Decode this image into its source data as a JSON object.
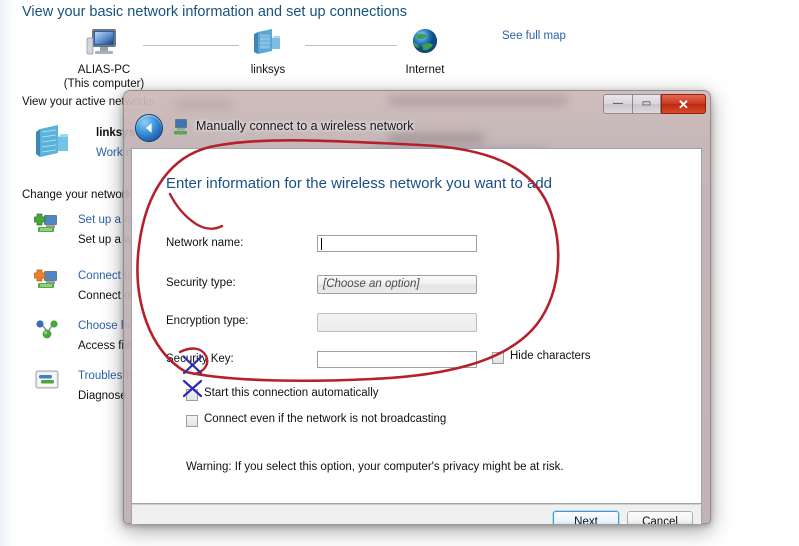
{
  "background_window": {
    "title": "View your basic network information and set up connections",
    "see_full_map_link": "See full map",
    "network_map": {
      "nodes": [
        {
          "icon": "computer-icon",
          "label": "ALIAS-PC",
          "sublabel": "(This computer)"
        },
        {
          "icon": "network-router-icon",
          "label": "linksys",
          "sublabel": ""
        },
        {
          "icon": "globe-icon",
          "label": "Internet",
          "sublabel": ""
        }
      ]
    },
    "active_networks_heading": "View your active networks",
    "active_network": {
      "icon": "network-servers-icon",
      "name": "linksys",
      "type": "Work network"
    },
    "change_settings_heading": "Change your network settings",
    "tasks": [
      {
        "icon": "set-up-connection-icon",
        "link": "Set up a new connection or network",
        "description": "Set up a wireless, broadband, dial-up, ad hoc or VPN connection; or set up a router or access point."
      },
      {
        "icon": "connect-to-network-icon",
        "link": "Connect to a network",
        "description": "Connect or reconnect to a wireless, wired, dial-up, or VPN network connection."
      },
      {
        "icon": "homegroup-icon",
        "link": "Choose homegroup and sharing options",
        "description": "Access files and printers located on other network computers, or change sharing settings."
      },
      {
        "icon": "troubleshoot-icon",
        "link": "Troubleshoot problems",
        "description": "Diagnose and repair network problems, or get troubleshooting information."
      }
    ]
  },
  "dialog": {
    "title": "Manually connect to a wireless network",
    "title_icon": "wireless-network-icon",
    "back_button": "back-arrow-icon",
    "window_buttons": {
      "minimize": "—",
      "maximize": "▭",
      "close": "✕"
    },
    "heading": "Enter information for the wireless network you want to add",
    "fields": [
      {
        "name": "network-name",
        "label": "Network name:",
        "control": "textbox",
        "value": "",
        "enabled": true
      },
      {
        "name": "security-type",
        "label": "Security type:",
        "control": "combobox",
        "value": "[Choose an option]",
        "enabled": true
      },
      {
        "name": "encryption-type",
        "label": "Encryption type:",
        "control": "combobox",
        "value": "",
        "enabled": false
      },
      {
        "name": "security-key",
        "label": "Security Key:",
        "control": "textbox",
        "value": "",
        "enabled": true
      }
    ],
    "hide_characters": {
      "label": "Hide characters",
      "checked": false
    },
    "checkboxes": [
      {
        "name": "start-connection-automatically",
        "label": "Start this connection automatically",
        "checked": false
      },
      {
        "name": "connect-even-if-not-broadcasting",
        "label": "Connect even if the network is not broadcasting",
        "checked": false
      }
    ],
    "warning": "Warning: If you select this option, your computer's privacy might be at risk.",
    "buttons": {
      "next": "Next",
      "cancel": "Cancel"
    }
  },
  "annotations": {
    "ink_color": "#b5202c",
    "mark_color": "#2a2ab4",
    "shapes": [
      {
        "type": "ellipse",
        "meaning": "circled-form-area"
      },
      {
        "type": "x-mark",
        "meaning": "cross-out-start-automatically-checkbox"
      },
      {
        "type": "x-mark",
        "meaning": "cross-out-connect-even-if-not-broadcasting-checkbox"
      }
    ]
  },
  "colors": {
    "link": "#2a63a8",
    "heading": "#16537e",
    "dialog_heading": "#1a4f86",
    "close_button": "#cf3b21"
  }
}
